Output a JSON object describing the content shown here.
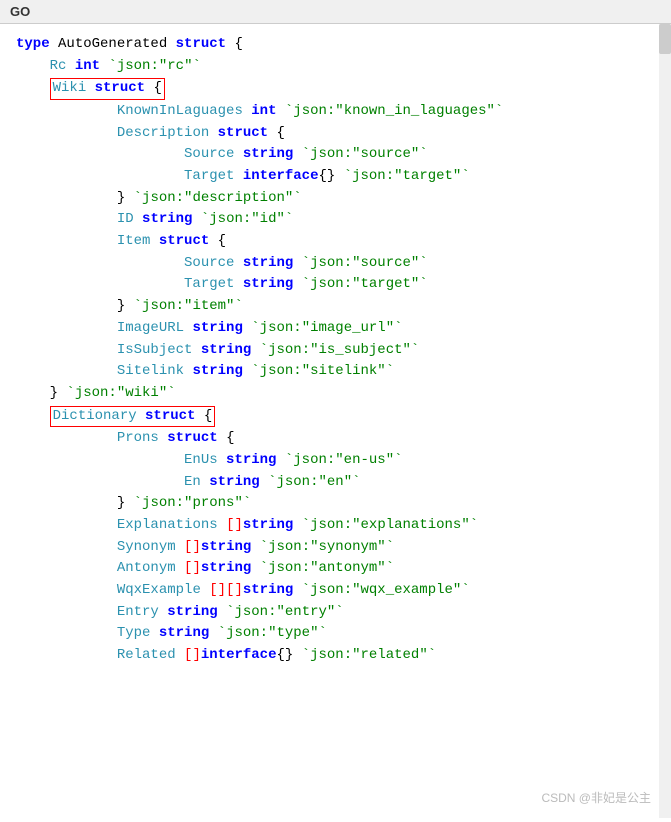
{
  "title": "GO",
  "watermark": "CSDN @非妃是公主",
  "lines": [
    {
      "id": "l1",
      "content": "type AutoGenerated struct {"
    },
    {
      "id": "l2",
      "content": "    Rc int `json:\"rc\"`"
    },
    {
      "id": "l3",
      "content": "    Wiki struct {",
      "boxed": true
    },
    {
      "id": "l4",
      "content": "            KnownInLaguages int `json:\"known_in_laguages\"`"
    },
    {
      "id": "l5",
      "content": "            Description struct {"
    },
    {
      "id": "l6",
      "content": "                    Source string `json:\"source\"`"
    },
    {
      "id": "l7",
      "content": "                    Target interface{} `json:\"target\"`"
    },
    {
      "id": "l8",
      "content": "            } `json:\"description\"`"
    },
    {
      "id": "l9",
      "content": "            ID string `json:\"id\"`"
    },
    {
      "id": "l10",
      "content": "            Item struct {"
    },
    {
      "id": "l11",
      "content": "                    Source string `json:\"source\"`"
    },
    {
      "id": "l12",
      "content": "                    Target string `json:\"target\"`"
    },
    {
      "id": "l13",
      "content": "            } `json:\"item\"`"
    },
    {
      "id": "l14",
      "content": "            ImageURL string `json:\"image_url\"`"
    },
    {
      "id": "l15",
      "content": "            IsSubject string `json:\"is_subject\"`"
    },
    {
      "id": "l16",
      "content": "            Sitelink string `json:\"sitelink\"`"
    },
    {
      "id": "l17",
      "content": "    } `json:\"wiki\"`"
    },
    {
      "id": "l18",
      "content": "    Dictionary struct {",
      "boxed": true
    },
    {
      "id": "l19",
      "content": "            Prons struct {"
    },
    {
      "id": "l20",
      "content": "                    EnUs string `json:\"en-us\"`"
    },
    {
      "id": "l21",
      "content": "                    En string `json:\"en\"`"
    },
    {
      "id": "l22",
      "content": "            } `json:\"prons\"`"
    },
    {
      "id": "l23",
      "content": "            Explanations []string `json:\"explanations\"`"
    },
    {
      "id": "l24",
      "content": "            Synonym []string `json:\"synonym\"`"
    },
    {
      "id": "l25",
      "content": "            Antonym []string `json:\"antonym\"`"
    },
    {
      "id": "l26",
      "content": "            WqxExample [][]string `json:\"wqx_example\"`"
    },
    {
      "id": "l27",
      "content": "            Entry string `json:\"entry\"`"
    },
    {
      "id": "l28",
      "content": "            Type string `json:\"type\"`"
    },
    {
      "id": "l29",
      "content": "            Related []interface{} `json:\"related\"`"
    }
  ]
}
